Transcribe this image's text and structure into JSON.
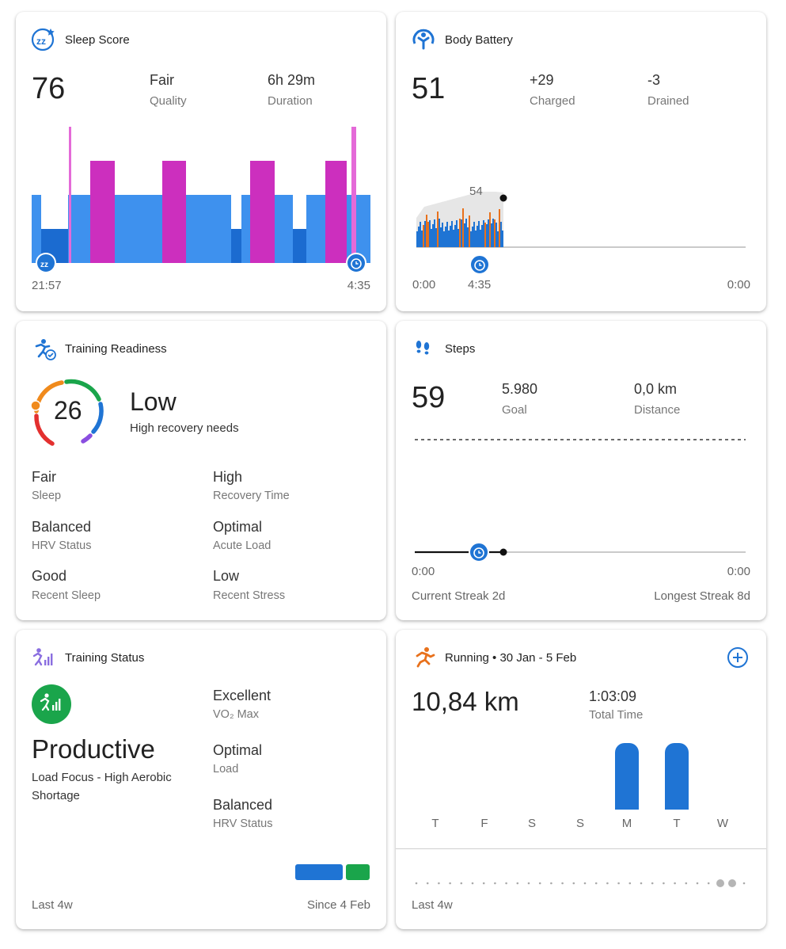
{
  "sleep": {
    "title": "Sleep Score",
    "score": "76",
    "quality_value": "Fair",
    "quality_label": "Quality",
    "duration_value": "6h 29m",
    "duration_label": "Duration",
    "start_time": "21:57",
    "end_time": "4:35",
    "colors": {
      "light": "#3e91ee",
      "deep": "#1b6bd0",
      "rem": "#cc2fbe",
      "awake": "#e46ad8"
    }
  },
  "body_battery": {
    "title": "Body Battery",
    "level": "51",
    "charged_value": "+29",
    "charged_label": "Charged",
    "drained_value": "-3",
    "drained_label": "Drained",
    "peak_label": "54",
    "axis_start": "0:00",
    "axis_wake": "4:35",
    "axis_end": "0:00"
  },
  "training_readiness": {
    "title": "Training Readiness",
    "score": "26",
    "level": "Low",
    "subtitle": "High recovery needs",
    "factors": [
      {
        "value": "Fair",
        "label": "Sleep"
      },
      {
        "value": "High",
        "label": "Recovery Time"
      },
      {
        "value": "Balanced",
        "label": "HRV Status"
      },
      {
        "value": "Optimal",
        "label": "Acute Load"
      },
      {
        "value": "Good",
        "label": "Recent Sleep"
      },
      {
        "value": "Low",
        "label": "Recent Stress"
      }
    ]
  },
  "steps": {
    "title": "Steps",
    "count": "59",
    "goal_value": "5.980",
    "goal_label": "Goal",
    "distance_value": "0,0 km",
    "distance_label": "Distance",
    "axis_start": "0:00",
    "axis_end": "0:00",
    "current_streak": "Current Streak 2d",
    "longest_streak": "Longest Streak 8d"
  },
  "training_status": {
    "title": "Training Status",
    "status": "Productive",
    "focus": "Load Focus - High Aerobic Shortage",
    "metrics": [
      {
        "value": "Excellent",
        "label": "VO₂ Max"
      },
      {
        "value": "Optimal",
        "label": "Load"
      },
      {
        "value": "Balanced",
        "label": "HRV Status"
      }
    ],
    "footer_left": "Last 4w",
    "footer_right": "Since 4 Feb",
    "colors": {
      "productive": "#1aa54b",
      "bar_blue": "#1f74d4"
    }
  },
  "running": {
    "title": "Running • 30 Jan - 5 Feb",
    "distance": "10,84 km",
    "total_time_value": "1:03:09",
    "total_time_label": "Total Time",
    "days": [
      "T",
      "F",
      "S",
      "S",
      "M",
      "T",
      "W"
    ],
    "footer_left": "Last 4w",
    "add_icon": "plus-circle-icon"
  },
  "chart_data": [
    {
      "type": "bar",
      "title": "Running • 30 Jan - 5 Feb",
      "categories": [
        "T",
        "F",
        "S",
        "S",
        "M",
        "T",
        "W"
      ],
      "values": [
        0,
        0,
        0,
        0,
        5.4,
        5.4,
        0
      ]
    }
  ]
}
